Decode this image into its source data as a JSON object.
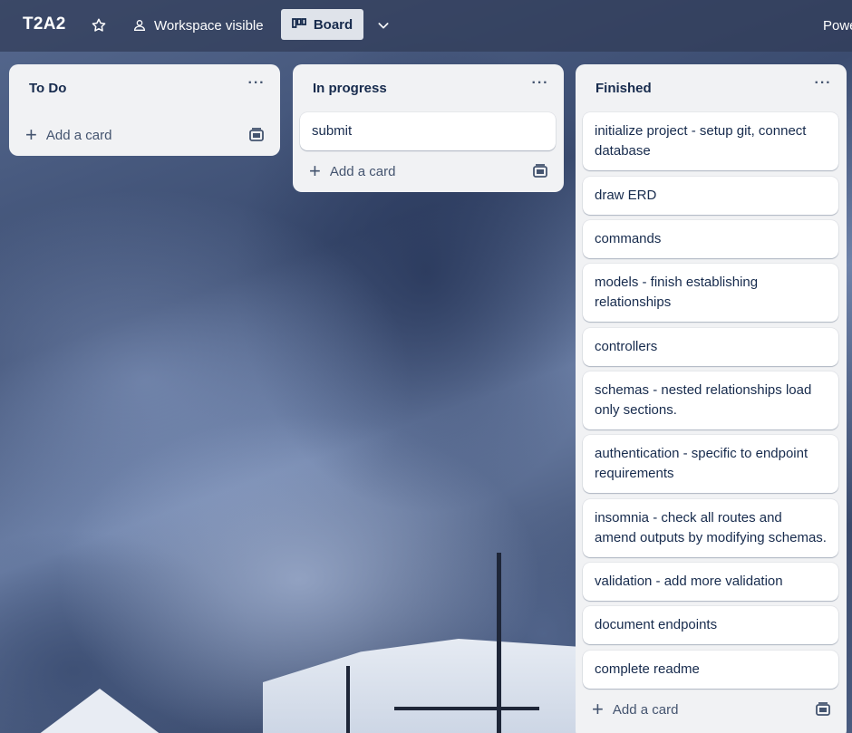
{
  "board": {
    "title": "T2A2",
    "visibility_label": "Workspace visible",
    "view_label": "Board",
    "power_ups_label": "Power-Ups"
  },
  "icons": {
    "star": "star-icon",
    "visibility": "workspace-icon",
    "board_view": "board-view-icon",
    "chevron": "chevron-down-icon",
    "power_ups": "rocket-icon",
    "list_menu": "more-icon",
    "add": "plus-icon",
    "template": "card-template-icon"
  },
  "colors": {
    "header_overlay": "#303c58",
    "list_bg": "#f1f2f4",
    "card_bg": "#ffffff",
    "text": "#172b4d",
    "muted_text": "#44546f"
  },
  "lists": [
    {
      "title": "To Do",
      "menu": "···",
      "cards": [],
      "add_card_label": "Add a card"
    },
    {
      "title": "In progress",
      "menu": "···",
      "cards": [
        "submit"
      ],
      "add_card_label": "Add a card"
    },
    {
      "title": "Finished",
      "menu": "···",
      "cards": [
        "initialize project - setup git, connect database",
        "draw ERD",
        "commands",
        "models - finish establishing relationships",
        "controllers",
        "schemas - nested relationships load only sections.",
        "authentication - specific to endpoint requirements",
        "insomnia - check all routes and amend outputs by modifying schemas.",
        "validation - add more validation",
        "document endpoints",
        "complete readme"
      ],
      "add_card_label": "Add a card"
    }
  ]
}
